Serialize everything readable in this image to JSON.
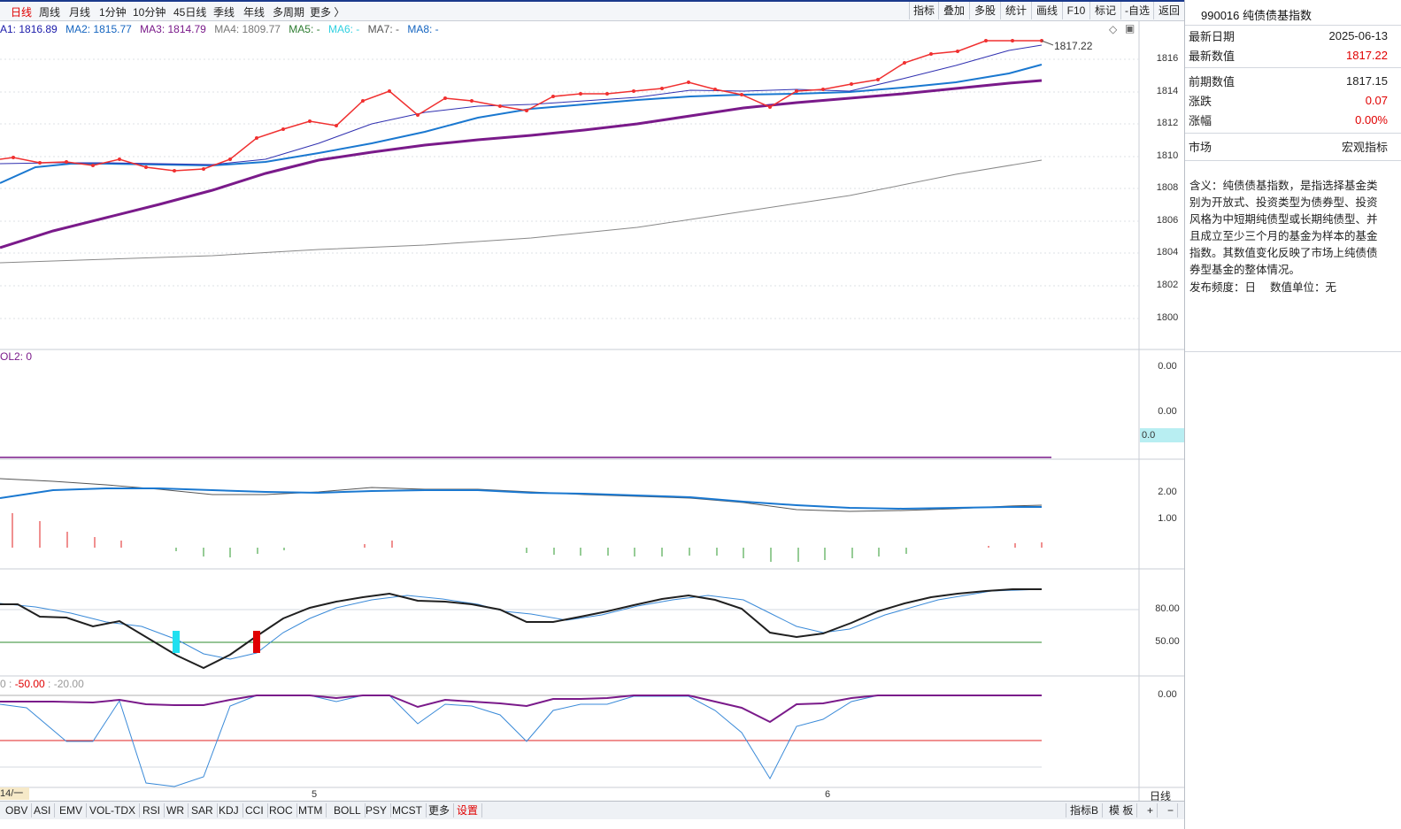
{
  "periods": [
    "日线",
    "周线",
    "月线",
    "1分钟",
    "10分钟",
    "45日线",
    "季线",
    "年线",
    "多周期",
    "更多 〉"
  ],
  "active_period": "日线",
  "tools": [
    "指标",
    "叠加",
    "多股",
    "统计",
    "画线",
    "F10",
    "标记",
    "-自选",
    "返回"
  ],
  "ma_legend": [
    {
      "label": "A1: 1816.89",
      "color": "#1a1aaa"
    },
    {
      "label": "MA2: 1815.77",
      "color": "#1565c0"
    },
    {
      "label": "MA3: 1814.79",
      "color": "#7a1a8a"
    },
    {
      "label": "MA4: 1809.77",
      "color": "#777777"
    },
    {
      "label": "MA5: -",
      "color": "#2e7d32"
    },
    {
      "label": "MA6: -",
      "color": "#30d0e0"
    },
    {
      "label": "MA7: -",
      "color": "#555555"
    },
    {
      "label": "MA8: -",
      "color": "#1565c0"
    }
  ],
  "price_axis": [
    "1816",
    "1814",
    "1812",
    "1810",
    "1808",
    "1806",
    "1804",
    "1802",
    "1800"
  ],
  "last_price_tag": "1817.22",
  "vol_label": "OL2: 0",
  "vol_axis": [
    "0.00",
    "0.00"
  ],
  "vol_tag": "0.0",
  "macd_axis": [
    "2.00",
    "1.00"
  ],
  "kdj_axis": [
    "80.00",
    "50.00"
  ],
  "wr_label": {
    "prefix": "0 : ",
    "v1": "-50.00",
    "sep": " : ",
    "v2": "-20.00"
  },
  "wr_axis": [
    "0.00"
  ],
  "date_labels": [
    "14/一",
    "5",
    "6"
  ],
  "period_corner": "日线",
  "indicator_tabs": [
    "OBV",
    "ASI",
    "EMV",
    "VOL-TDX",
    "RSI",
    "WR",
    "SAR",
    "KDJ",
    "CCI",
    "ROC",
    "MTM",
    "BOLL",
    "PSY",
    "MCST",
    "更多"
  ],
  "settings_tab": "设置",
  "bottom_right": [
    "指标B",
    "模 板",
    "+",
    "−"
  ],
  "info": {
    "title": "990016 纯债债基指数",
    "rows": [
      {
        "k": "最新日期",
        "v": "2025-06-13",
        "red": false
      },
      {
        "k": "最新数值",
        "v": "1817.22",
        "red": true
      },
      {
        "k": "前期数值",
        "v": "1817.15",
        "red": false
      },
      {
        "k": "涨跌",
        "v": "0.07",
        "red": true
      },
      {
        "k": "涨幅",
        "v": "0.00%",
        "red": true
      },
      {
        "k": "市场",
        "v": "宏观指标",
        "red": false
      }
    ],
    "desc": "含义：纯债债基指数，是指选择基金类别为开放式、投资类型为债券型、投资风格为中短期纯债型或长期纯债型、并且成立至少三个月的基金为样本的基金指数。其数值变化反映了市场上纯债债券型基金的整体情况。",
    "freq": "发布频度：日　 数值单位：无"
  }
}
